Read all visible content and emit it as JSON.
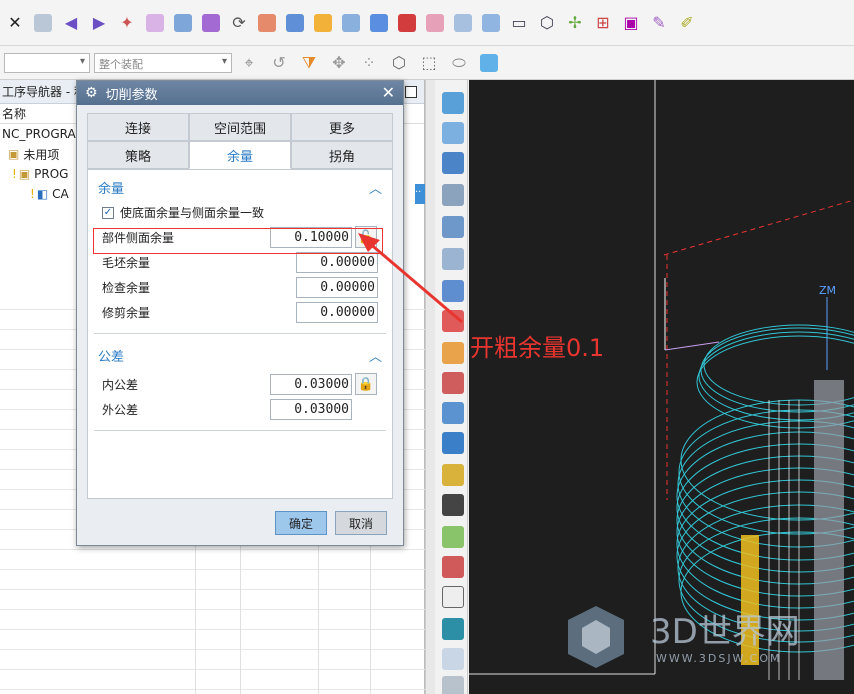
{
  "navigator": {
    "title": "工序导航器 - 程",
    "column_name": "名称",
    "rows": [
      "NC_PROGRAM",
      "未用项",
      "PROG",
      "CA"
    ],
    "selected_marker": ".."
  },
  "toolbar2": {
    "combo_value": "整个装配"
  },
  "dialog": {
    "title": "切削参数",
    "tabs_row1": [
      "连接",
      "空间范围",
      "更多"
    ],
    "tabs_row2": [
      "策略",
      "余量",
      "拐角"
    ],
    "active_tab": "余量",
    "section_stock": "余量",
    "checkbox_label": "使底面余量与侧面余量一致",
    "fields": {
      "part_side_stock_label": "部件侧面余量",
      "part_side_stock_value": "0.10000",
      "blank_stock_label": "毛坯余量",
      "blank_stock_value": "0.00000",
      "check_stock_label": "检查余量",
      "check_stock_value": "0.00000",
      "trim_stock_label": "修剪余量",
      "trim_stock_value": "0.00000"
    },
    "section_tolerance": "公差",
    "tolerance": {
      "intol_label": "内公差",
      "intol_value": "0.03000",
      "outtol_label": "外公差",
      "outtol_value": "0.03000"
    },
    "ok_label": "确定",
    "cancel_label": "取消"
  },
  "annotation": "开粗余量0.1",
  "graphics": {
    "axis_label": "ZM"
  },
  "watermark": {
    "brand": "3D世界网",
    "url": "WWW.3DSJW.COM"
  },
  "colors": {
    "accent": "#2c7cc4",
    "annotation_red": "#e8352f",
    "toolpath_cyan": "#35d6e6"
  }
}
